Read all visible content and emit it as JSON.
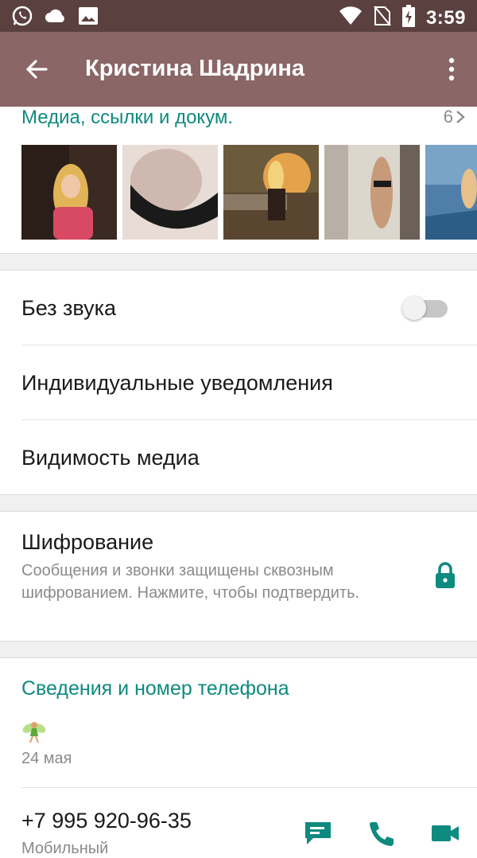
{
  "status_bar": {
    "time": "3:59",
    "left_icons": [
      "whatsapp-icon",
      "cloud-icon",
      "image-icon"
    ],
    "right_icons": [
      "wifi-icon",
      "no-sim-icon",
      "battery-charging-icon"
    ]
  },
  "app_bar": {
    "title": "Кристина Шадрина",
    "back_icon": "arrow-left-icon",
    "menu_icon": "more-vert-icon"
  },
  "media": {
    "title": "Медиа, ссылки и докум.",
    "count": "6",
    "thumbnails": [
      {
        "colors": [
          "#2b1e18",
          "#e2b458",
          "#d84a63"
        ]
      },
      {
        "colors": [
          "#e3cfc8",
          "#cfb8b0",
          "#1a1a1a"
        ]
      },
      {
        "colors": [
          "#6b5a3c",
          "#e4a24a",
          "#2e2018"
        ]
      },
      {
        "colors": [
          "#dcd7cd",
          "#c79a7a",
          "#6b6158"
        ]
      },
      {
        "colors": [
          "#4f7ea8",
          "#e8c08a",
          "#2b5d86"
        ]
      }
    ]
  },
  "settings": {
    "mute_label": "Без звука",
    "mute_on": false,
    "custom_notifications_label": "Индивидуальные уведомления",
    "media_visibility_label": "Видимость медиа"
  },
  "encryption": {
    "title": "Шифрование",
    "description": "Сообщения и звонки защищены сквозным шифрованием. Нажмите, чтобы подтвердить."
  },
  "about": {
    "title": "Сведения и номер телефона",
    "status_emoji": "🧚",
    "date": "24 мая",
    "phone": "+7 995 920-96-35",
    "phone_type": "Мобильный"
  },
  "colors": {
    "accent": "#0e8a7f",
    "app_bar": "#8a6666",
    "status_bar": "#5b4040"
  }
}
